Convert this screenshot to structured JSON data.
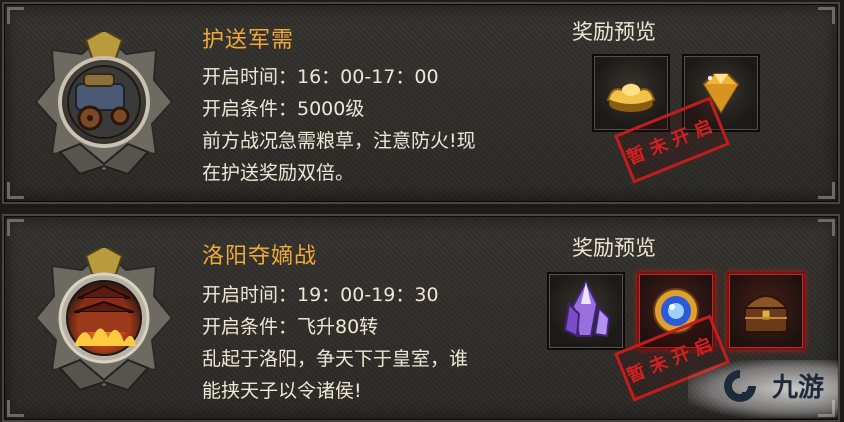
{
  "events": [
    {
      "title": "护送军需",
      "time_line": "开启时间：16：00-17：00",
      "condition_line": "开启条件：5000级",
      "desc_line1": "前方战况急需粮草，注意防火!现",
      "desc_line2": "在护送奖励双倍。",
      "reward_title": "奖励预览",
      "stamp": "暂未开启",
      "rewards": [
        "gold-ingot-icon",
        "gold-diamond-icon"
      ]
    },
    {
      "title": "洛阳夺嫡战",
      "time_line": "开启时间：19：00-19：30",
      "condition_line": "开启条件：飞升80转",
      "desc_line1": "乱起于洛阳，争天下于皇室，谁",
      "desc_line2": "能挟天子以令诸侯!",
      "reward_title": "奖励预览",
      "stamp": "暂未开启",
      "rewards": [
        "purple-crystal-icon",
        "blue-orb-icon",
        "treasure-chest-icon"
      ]
    }
  ],
  "watermark": {
    "text": "九游"
  },
  "colors": {
    "title": "#f0a93a",
    "body_text": "#efe7d6",
    "stamp_red": "#c21d1d",
    "panel_bg": "#2f2d29"
  }
}
